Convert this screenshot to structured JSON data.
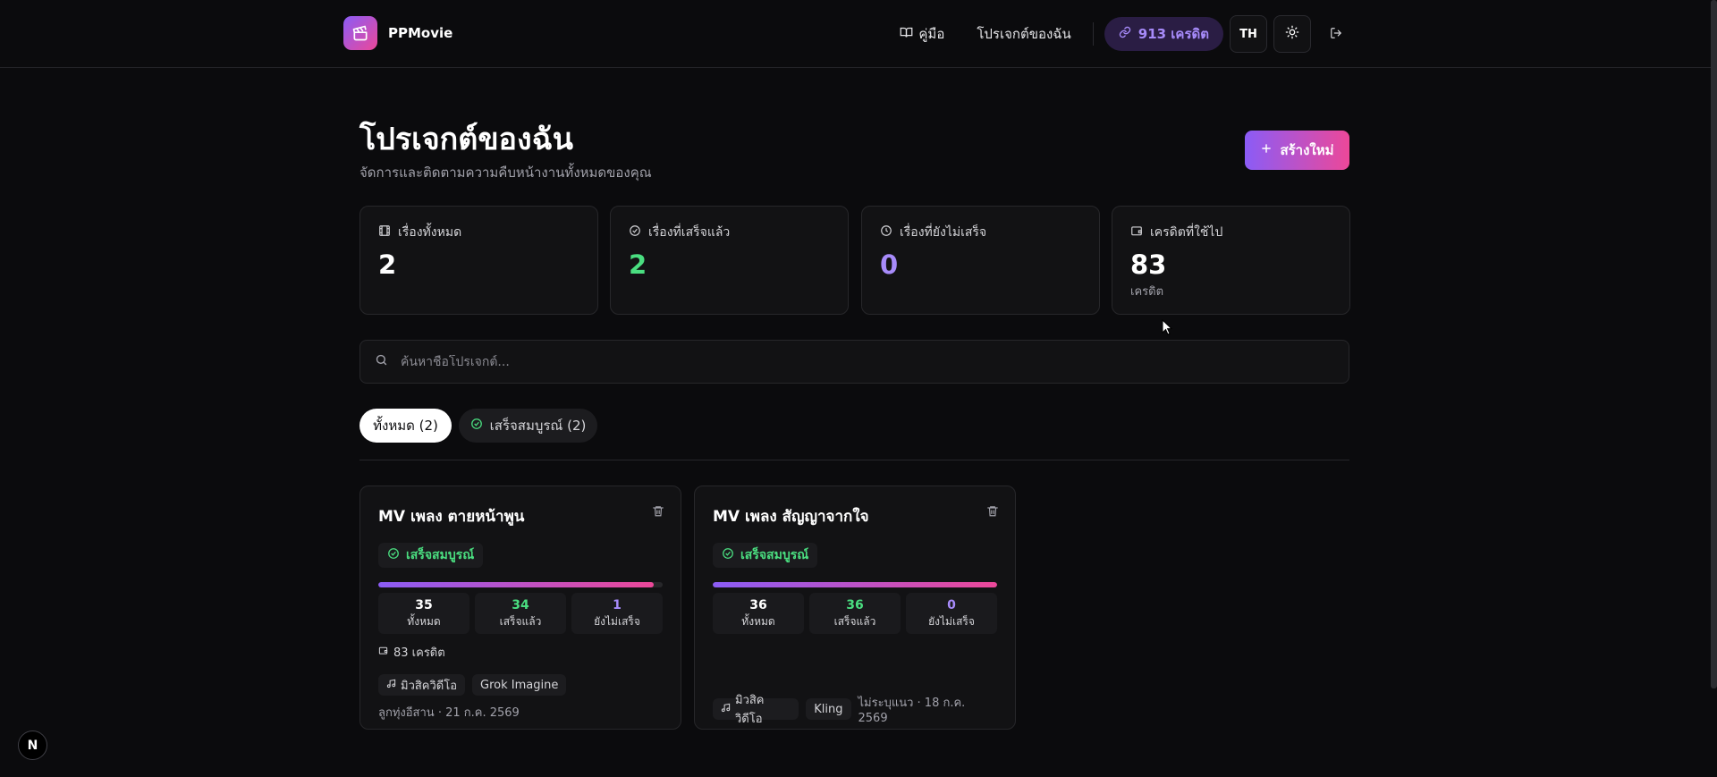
{
  "app": {
    "name": "PPMovie"
  },
  "nav": {
    "guide": "คู่มือ",
    "my_projects": "โปรเจกต์ของฉัน",
    "credits": "913 เครดิต",
    "lang": "TH"
  },
  "header": {
    "title": "โปรเจกต์ของฉัน",
    "subtitle": "จัดการและติดตามความคืบหน้างานทั้งหมดของคุณ",
    "create_label": "สร้างใหม่"
  },
  "stats": [
    {
      "label": "เรื่องทั้งหมด",
      "value": "2",
      "color": "#ffffff",
      "icon": "film-icon"
    },
    {
      "label": "เรื่องที่เสร็จแล้ว",
      "value": "2",
      "color": "#4ade80",
      "icon": "check-circle-icon"
    },
    {
      "label": "เรื่องที่ยังไม่เสร็จ",
      "value": "0",
      "color": "#a78bfa",
      "icon": "clock-icon"
    },
    {
      "label": "เครดิตที่ใช้ไป",
      "value": "83",
      "unit": "เครดิต",
      "color": "#ffffff",
      "icon": "wallet-icon"
    }
  ],
  "search": {
    "placeholder": "ค้นหาชื่อโปรเจกต์..."
  },
  "filters": {
    "all": "ทั้งหมด (2)",
    "done": "เสร็จสมบูรณ์ (2)"
  },
  "projects": [
    {
      "title": "MV เพลง ตายหน้าพูน",
      "status": "เสร็จสมบูรณ์",
      "progress": 0.97,
      "counts": [
        {
          "num": "35",
          "label": "ทั้งหมด",
          "color": "#ffffff"
        },
        {
          "num": "34",
          "label": "เสร็จแล้ว",
          "color": "#4ade80"
        },
        {
          "num": "1",
          "label": "ยังไม่เสร็จ",
          "color": "#a78bfa"
        }
      ],
      "credits": "83 เครดิต",
      "tag_type": "มิวสิควิดีโอ",
      "tag_model": "Grok Imagine",
      "meta": "ลูกทุ่งอีสาน · 21 ก.ค. 2569"
    },
    {
      "title": "MV เพลง สัญญาจากใจ",
      "status": "เสร็จสมบูรณ์",
      "progress": 1.0,
      "counts": [
        {
          "num": "36",
          "label": "ทั้งหมด",
          "color": "#ffffff"
        },
        {
          "num": "36",
          "label": "เสร็จแล้ว",
          "color": "#4ade80"
        },
        {
          "num": "0",
          "label": "ยังไม่เสร็จ",
          "color": "#a78bfa"
        }
      ],
      "tag_type": "มิวสิควิดีโอ",
      "tag_model": "Kling",
      "meta": "ไม่ระบุแนว · 18 ก.ค. 2569"
    }
  ],
  "dev_badge": "N"
}
